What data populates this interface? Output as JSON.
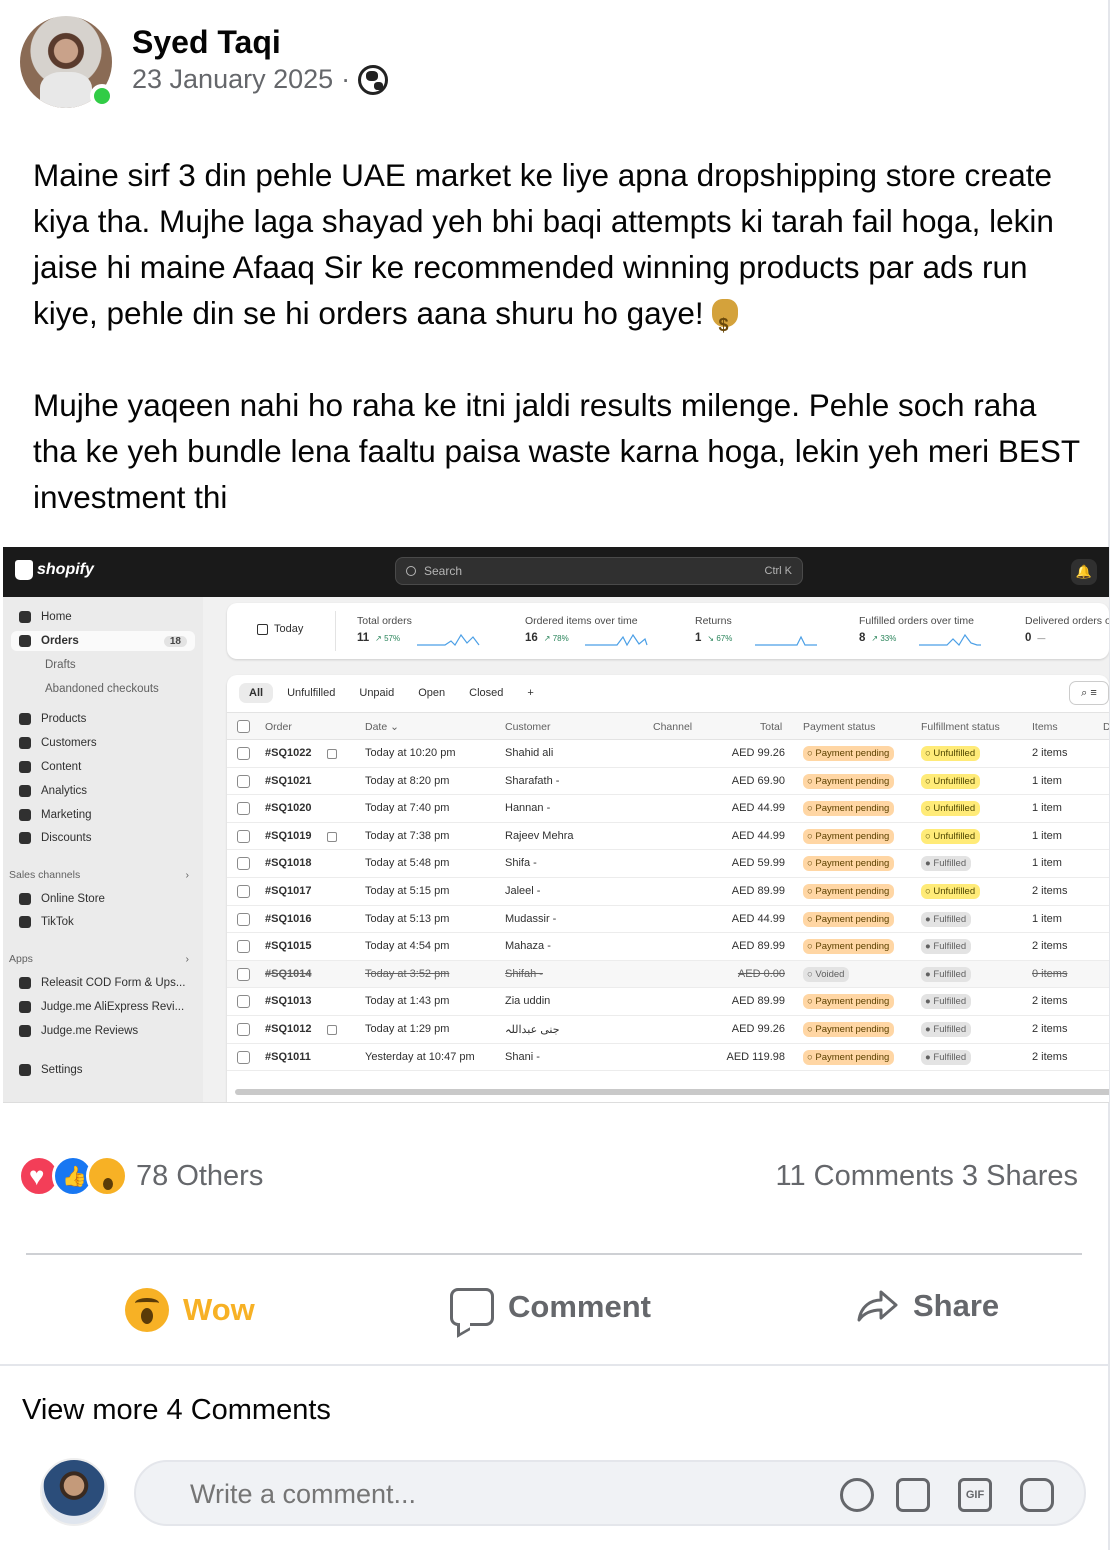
{
  "post": {
    "author": "Syed Taqi",
    "date": "23 January 2025",
    "separator": "·",
    "privacy_icon": "globe-icon",
    "paragraph1": "Maine sirf 3 din pehle UAE market ke liye apna dropshipping store create kiya tha. Mujhe laga shayad yeh bhi baqi attempts ki tarah fail hoga, lekin jaise hi maine Afaaq Sir ke recommended winning products par ads run kiye, pehle din se hi orders aana shuru ho gaye!",
    "paragraph1_emoji": "money-bag-icon",
    "paragraph2": "Mujhe yaqeen nahi ho raha ke itni jaldi results milenge. Pehle soch raha tha ke yeh bundle lena faaltu paisa waste karna hoga, lekin yeh meri BEST investment thi"
  },
  "shopify": {
    "logo": "shopify",
    "search_placeholder": "Search",
    "search_shortcut": "Ctrl K",
    "nav": [
      {
        "label": "Home"
      },
      {
        "label": "Orders",
        "badge": "18"
      },
      {
        "label": "Drafts"
      },
      {
        "label": "Abandoned checkouts"
      },
      {
        "label": "Products"
      },
      {
        "label": "Customers"
      },
      {
        "label": "Content"
      },
      {
        "label": "Analytics"
      },
      {
        "label": "Marketing"
      },
      {
        "label": "Discounts"
      }
    ],
    "sales_channels_label": "Sales channels",
    "channels": [
      {
        "label": "Online Store"
      },
      {
        "label": "TikTok"
      }
    ],
    "apps_label": "Apps",
    "apps": [
      {
        "label": "Releasit COD Form & Ups..."
      },
      {
        "label": "Judge.me AliExpress Revi..."
      },
      {
        "label": "Judge.me Reviews"
      }
    ],
    "settings_label": "Settings",
    "metrics": {
      "period": "Today",
      "items": [
        {
          "label": "Total orders",
          "value": "11",
          "change": "↗ 57%"
        },
        {
          "label": "Ordered items over time",
          "value": "16",
          "change": "↗ 78%"
        },
        {
          "label": "Returns",
          "value": "1",
          "change": "↘ 67%"
        },
        {
          "label": "Fulfilled orders over time",
          "value": "8",
          "change": "↗ 33%"
        },
        {
          "label": "Delivered orders o",
          "value": "0",
          "change": "—"
        }
      ]
    },
    "tabs": [
      "All",
      "Unfulfilled",
      "Unpaid",
      "Open",
      "Closed",
      "+"
    ],
    "columns": {
      "order": "Order",
      "date": "Date ⌄",
      "customer": "Customer",
      "channel": "Channel",
      "total": "Total",
      "payment": "Payment status",
      "fulfillment": "Fulfillment status",
      "items": "Items",
      "delivery": "D"
    },
    "orders": [
      {
        "id": "#SQ1022",
        "note": true,
        "date": "Today at 10:20 pm",
        "customer": "Shahid ali",
        "total": "AED 99.26",
        "payment": "Payment pending",
        "fulfillment": "Unfulfilled",
        "items": "2 items"
      },
      {
        "id": "#SQ1021",
        "note": false,
        "date": "Today at 8:20 pm",
        "customer": "Sharafath -",
        "total": "AED 69.90",
        "payment": "Payment pending",
        "fulfillment": "Unfulfilled",
        "items": "1 item"
      },
      {
        "id": "#SQ1020",
        "note": false,
        "date": "Today at 7:40 pm",
        "customer": "Hannan -",
        "total": "AED 44.99",
        "payment": "Payment pending",
        "fulfillment": "Unfulfilled",
        "items": "1 item"
      },
      {
        "id": "#SQ1019",
        "note": true,
        "date": "Today at 7:38 pm",
        "customer": "Rajeev Mehra",
        "total": "AED 44.99",
        "payment": "Payment pending",
        "fulfillment": "Unfulfilled",
        "items": "1 item"
      },
      {
        "id": "#SQ1018",
        "note": false,
        "date": "Today at 5:48 pm",
        "customer": "Shifa -",
        "total": "AED 59.99",
        "payment": "Payment pending",
        "fulfillment": "Fulfilled",
        "items": "1 item"
      },
      {
        "id": "#SQ1017",
        "note": false,
        "date": "Today at 5:15 pm",
        "customer": "Jaleel -",
        "total": "AED 89.99",
        "payment": "Payment pending",
        "fulfillment": "Unfulfilled",
        "items": "2 items"
      },
      {
        "id": "#SQ1016",
        "note": false,
        "date": "Today at 5:13 pm",
        "customer": "Mudassir -",
        "total": "AED 44.99",
        "payment": "Payment pending",
        "fulfillment": "Fulfilled",
        "items": "1 item"
      },
      {
        "id": "#SQ1015",
        "note": false,
        "date": "Today at 4:54 pm",
        "customer": "Mahaza -",
        "total": "AED 89.99",
        "payment": "Payment pending",
        "fulfillment": "Fulfilled",
        "items": "2 items"
      },
      {
        "id": "#SQ1014",
        "note": false,
        "date": "Today at 3:52 pm",
        "customer": "Shifah -",
        "total": "AED 0.00",
        "payment": "Voided",
        "fulfillment": "Fulfilled",
        "items": "0 items",
        "voided": true
      },
      {
        "id": "#SQ1013",
        "note": false,
        "date": "Today at 1:43 pm",
        "customer": "Zia uddin",
        "total": "AED 89.99",
        "payment": "Payment pending",
        "fulfillment": "Fulfilled",
        "items": "2 items"
      },
      {
        "id": "#SQ1012",
        "note": true,
        "date": "Today at 1:29 pm",
        "customer": "جنی عبداللہ",
        "total": "AED 99.26",
        "payment": "Payment pending",
        "fulfillment": "Fulfilled",
        "items": "2 items"
      },
      {
        "id": "#SQ1011",
        "note": false,
        "date": "Yesterday at 10:47 pm",
        "customer": "Shani -",
        "total": "AED 119.98",
        "payment": "Payment pending",
        "fulfillment": "Fulfilled",
        "items": "2 items"
      }
    ]
  },
  "engagement": {
    "reaction_icons": [
      "love-icon",
      "like-icon",
      "wow-icon"
    ],
    "reactions": "78 Others",
    "stats": "11 Comments 3 Shares",
    "wow_label": "Wow",
    "comment_label": "Comment",
    "share_label": "Share",
    "wow_color": "#f7b125",
    "view_more": "View more 4 Comments",
    "comment_placeholder": "Write a comment..."
  }
}
